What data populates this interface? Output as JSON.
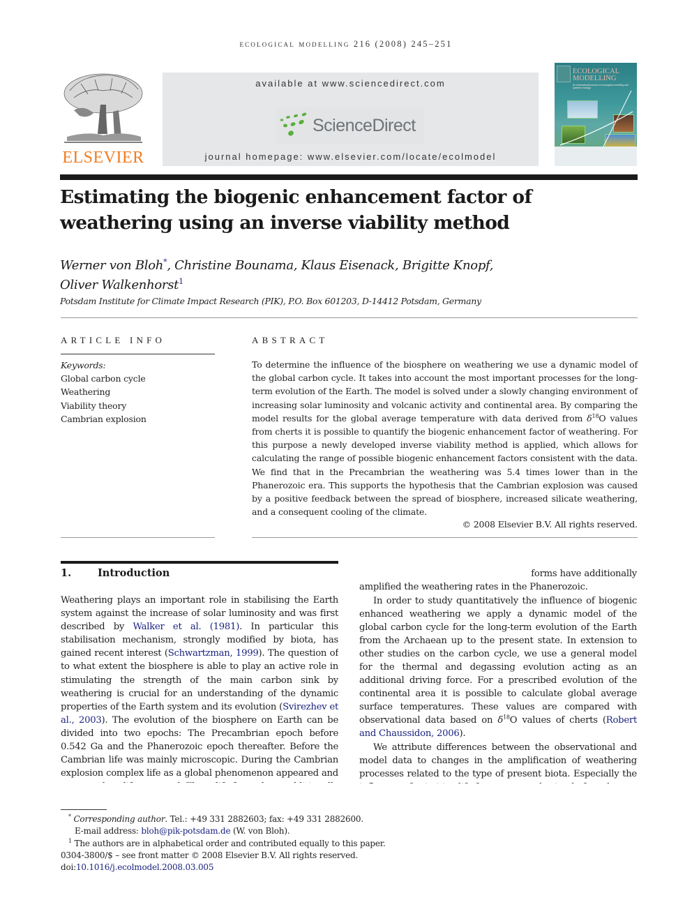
{
  "header": {
    "running_head": "ECOLOGICAL MODELLING 216 (2008) 245–251",
    "publisher_logo": "ELSEVIER",
    "available_at": "available at www.sciencedirect.com",
    "sciencedirect_logo": "ScienceDirect",
    "journal_homepage": "journal homepage: www.elsevier.com/locate/ecolmodel",
    "cover": {
      "title_line1": "ECOLOGICAL",
      "title_line2": "MODELLING",
      "subtitle": "An international journal on ecological modelling and systems ecology"
    },
    "brand_colors": {
      "elsevier_orange": "#f07c1f",
      "sciencedirect_green": "#5aaf3c",
      "link_blue": "#1a237e"
    }
  },
  "article": {
    "title": "Estimating the biogenic enhancement factor of weathering using an inverse viability method",
    "authors": [
      {
        "name": "Werner von Bloh",
        "mark": "*"
      },
      {
        "name": "Christine Bounama",
        "mark": ""
      },
      {
        "name": "Klaus Eisenack",
        "mark": ""
      },
      {
        "name": "Brigitte Knopf",
        "mark": ""
      },
      {
        "name": "Oliver Walkenhorst",
        "mark": "1"
      }
    ],
    "affiliation": "Potsdam Institute for Climate Impact Research (PIK), P.O. Box 601203, D-14412 Potsdam, Germany"
  },
  "article_info": {
    "heading": "ARTICLE INFO",
    "keywords_label": "Keywords:",
    "keywords": [
      "Global carbon cycle",
      "Weathering",
      "Viability theory",
      "Cambrian explosion"
    ]
  },
  "abstract": {
    "heading": "ABSTRACT",
    "text_before_delta": "To determine the influence of the biosphere on weathering we use a dynamic model of the global carbon cycle. It takes into account the most important processes for the long-term evolution of the Earth. The model is solved under a slowly changing environment of increasing solar luminosity and volcanic activity and continental area. By comparing the model results for the global average temperature with data derived from ",
    "delta": "δ",
    "delta_sup": "18",
    "text_after_delta": "O values from cherts it is possible to quantify the biogenic enhancement factor of weathering. For this purpose a newly developed inverse viability method is applied, which allows for calculating the range of possible biogenic enhancement factors consistent with the data. We find that in the Precambrian the weathering was 5.4 times lower than in the Phanerozoic era. This supports the hypothesis that the Cambrian explosion was caused by a positive feedback between the spread of biosphere, increased silicate weathering, and a consequent cooling of the climate.",
    "copyright": "© 2008 Elsevier B.V. All rights reserved."
  },
  "introduction": {
    "number": "1.",
    "title": "Introduction",
    "p1": {
      "a": "Weathering plays an important role in stabilising the Earth system against the increase of solar luminosity and was first described by ",
      "ref1": "Walker et al. (1981)",
      "b": ". In particular this stabilisation mechanism, strongly modified by biota, has gained recent interest (",
      "ref2": "Schwartzman, 1999",
      "c": "). The question of to what extent the biosphere is able to play an active role in stimulating the strength of the main carbon sink by weathering is crucial for an understanding of the dynamic properties of the Earth system and its evolution (",
      "ref3": "Svirezhev et al., 2003",
      "d": "). The evolution of the biosphere on Earth can be divided into two epochs: The Precambrian epoch before 0.542 Ga and the Phanerozoic epoch thereafter. Before the Cambrian life was mainly microscopic. During the Cambrian explosion complex life as a global phenomenon appeared and most modern life emerged. These life forms have additionally amplified the weathering rates in the Phanerozoic."
    },
    "p2": {
      "a": "In order to study quantitatively the influence of biogenic enhanced weathering we apply a dynamic model of the global carbon cycle for the long-term evolution of the Earth from the Archaean up to the present state. In extension to other studies on the carbon cycle, we use a general model for the thermal and degassing evolution acting as an additional driving force. For a prescribed evolution of the continental area it is possible to calculate global average surface temperatures. These values are compared with observational data based on ",
      "delta": "δ",
      "delta_sup": "18",
      "b": "O values of cherts (",
      "ref": "Robert and Chaussidon, 2006",
      "c": ")."
    },
    "p3": "We attribute differences between the observational and model data to changes in the amplification of weathering processes related to the type of present biota. Especially the influence of primitive life forms on weathering before the"
  },
  "footnotes": {
    "corr_mark": "*",
    "corr_label": "Corresponding author",
    "corr_text": ". Tel.: +49 331 2882603; fax: +49 331 2882600.",
    "email_label": "E-mail address: ",
    "email": "bloh@pik-potsdam.de",
    "email_suffix": " (W. von Bloh).",
    "note1_mark": "1",
    "note1_text": "The authors are in alphabetical order and contributed equally to this paper.",
    "front_matter": "0304-3800/$ – see front matter © 2008 Elsevier B.V. All rights reserved.",
    "doi_label": "doi:",
    "doi": "10.1016/j.ecolmodel.2008.03.005"
  }
}
